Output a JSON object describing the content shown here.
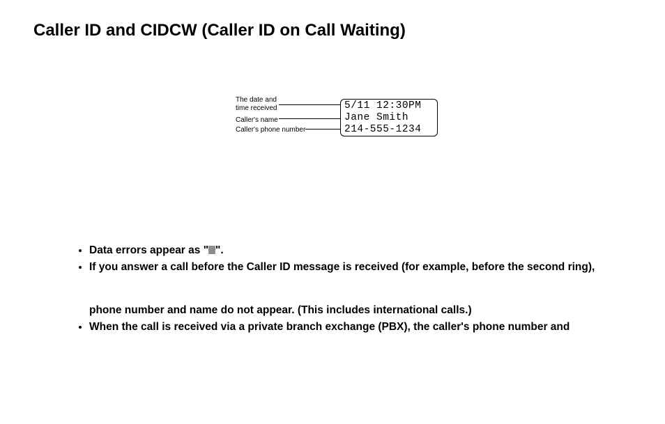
{
  "title": "Caller ID and CIDCW (Caller ID on Call Waiting)",
  "diagram": {
    "labels": {
      "date_line1": "The date and",
      "date_line2": "time received",
      "name": "Caller's name",
      "phone": "Caller's phone number"
    },
    "display": {
      "datetime": "5/11 12:30PM",
      "name": "Jane Smith",
      "phone": "214-555-1234"
    }
  },
  "bullets": {
    "b1_pre": "Data errors appear as \"",
    "b1_post": "\".",
    "b2_line1": "If you answer a call before the Caller ID message is received (for example, before the second ring),",
    "b2_line2": "phone number and name do not appear. (This includes international calls.)",
    "b3": "When the call is received via a private branch exchange (PBX), the caller's phone number and"
  }
}
